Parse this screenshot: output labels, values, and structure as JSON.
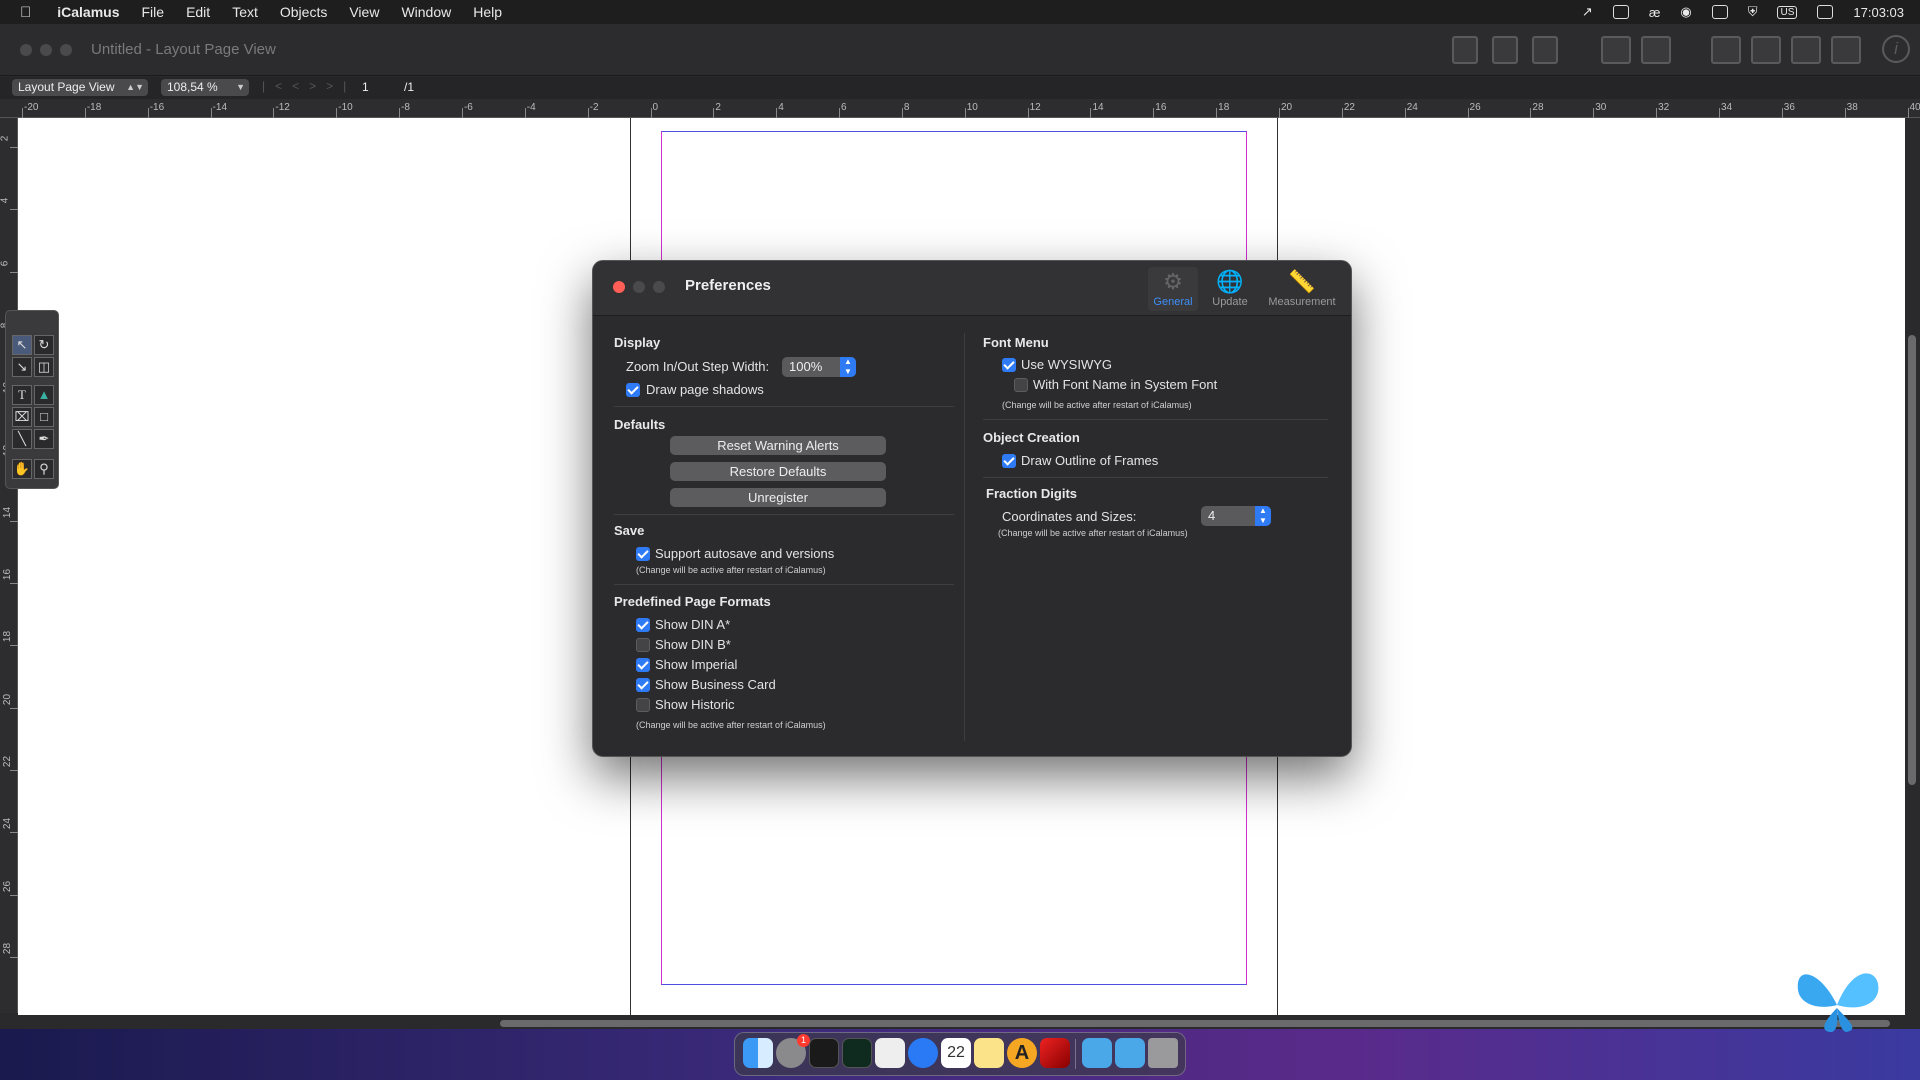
{
  "menubar": {
    "app_name": "iCalamus",
    "items": [
      "File",
      "Edit",
      "Text",
      "Objects",
      "View",
      "Window",
      "Help"
    ],
    "clock": "17:03:03",
    "keyboard_layout": "US"
  },
  "window": {
    "title": "Untitled - Layout Page View"
  },
  "viewbar": {
    "view_mode": "Layout Page View",
    "zoom": "108,54 %",
    "page_number": "1",
    "page_total": "/1"
  },
  "ruler": {
    "h_labels": [
      "-20",
      "-18",
      "-16",
      "-14",
      "-12",
      "-10",
      "-8",
      "-6",
      "-4",
      "-2",
      "0",
      "2",
      "4",
      "6",
      "8",
      "10",
      "12",
      "14",
      "16",
      "18",
      "20",
      "22",
      "24",
      "26",
      "28",
      "30",
      "32",
      "34",
      "36",
      "38",
      "40"
    ],
    "v_labels": [
      "2",
      "4",
      "6",
      "8",
      "10",
      "12",
      "14",
      "16",
      "18",
      "20",
      "22",
      "24",
      "26",
      "28"
    ]
  },
  "preferences": {
    "title": "Preferences",
    "tabs": [
      {
        "label": "General",
        "icon": "gears-icon"
      },
      {
        "label": "Update",
        "icon": "globe-icon"
      },
      {
        "label": "Measurement",
        "icon": "ruler-icon"
      }
    ],
    "display": {
      "heading": "Display",
      "zoom_label": "Zoom In/Out Step Width:",
      "zoom_value": "100%",
      "draw_shadows_label": "Draw page shadows",
      "draw_shadows_checked": true
    },
    "defaults": {
      "heading": "Defaults",
      "reset_warning_label": "Reset Warning Alerts",
      "restore_defaults_label": "Restore Defaults",
      "unregister_label": "Unregister"
    },
    "save": {
      "heading": "Save",
      "autosave_label": "Support autosave and versions",
      "autosave_checked": true,
      "note": "(Change will be active after restart of iCalamus)"
    },
    "page_formats": {
      "heading": "Predefined Page Formats",
      "items": [
        {
          "label": "Show DIN A*",
          "checked": true
        },
        {
          "label": "Show DIN B*",
          "checked": false
        },
        {
          "label": "Show Imperial",
          "checked": true
        },
        {
          "label": "Show Business Card",
          "checked": true
        },
        {
          "label": "Show Historic",
          "checked": false
        }
      ],
      "note": "(Change will be active after restart of iCalamus)"
    },
    "font_menu": {
      "heading": "Font Menu",
      "wysiwyg_label": "Use WYSIWYG",
      "wysiwyg_checked": true,
      "system_font_label": "With Font Name in System Font",
      "system_font_checked": false,
      "note": "(Change will be active after restart of iCalamus)"
    },
    "object_creation": {
      "heading": "Object Creation",
      "outline_label": "Draw Outline of Frames",
      "outline_checked": true
    },
    "fraction_digits": {
      "heading": "Fraction Digits",
      "coords_label": "Coordinates and Sizes:",
      "coords_value": "4",
      "note": "(Change will be active after restart of iCalamus)"
    }
  },
  "dock": {
    "apps": [
      "finder-icon",
      "system-settings-icon",
      "terminal-icon",
      "activity-monitor-icon",
      "textedit-icon",
      "safari-icon",
      "calendar-icon",
      "notes-icon",
      "icalamus-icon",
      "pen-app-icon",
      "downloads-folder-icon",
      "applications-folder-icon",
      "trash-icon"
    ],
    "calendar_day": "22",
    "settings_badge": "1"
  },
  "colors": {
    "accent": "#2f7bf5",
    "margin_guides": "#d030d0",
    "close_button": "#ff5f57"
  }
}
